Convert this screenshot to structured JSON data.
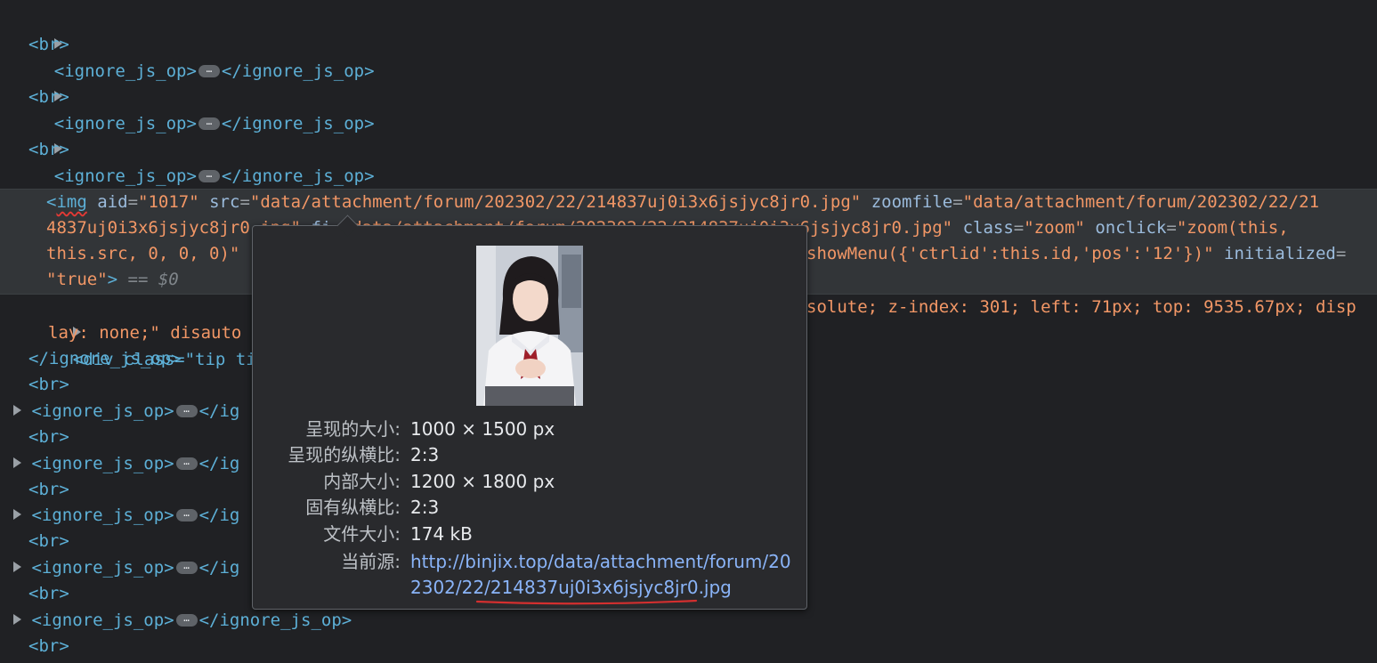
{
  "elements": {
    "ignore_tag_open": "<ignore_js_op>",
    "ignore_tag_close": "</ignore_js_op>",
    "br_tag": "<br>",
    "img_open": "<",
    "img_name": "img",
    "img_attr_aid": "aid",
    "img_val_aid": "\"1017\"",
    "img_attr_src": "src",
    "img_val_src": "\"data/attachment/forum/202302/22/214837uj0i3x6jsjyc8jr0.jpg\"",
    "img_attr_zoomfile": "zoomfile",
    "img_val_zoomfile_1": "\"data/attachment/forum/202302/22/21",
    "img_val_zoomfile_2": "4837uj0i3x6jsjyc8jr0.jpg\"",
    "img_attr_file_partial": "fi",
    "img_val_file": "\"data/attachment/forum/202302/22/214837uj0i3x6jsjyc8jr0.jpg\"",
    "img_attr_class": "class",
    "img_val_class": "\"zoom\"",
    "img_attr_onclick": "onclick",
    "img_val_onclick_1": "\"zoom(this,",
    "img_val_onclick_2": "this.src, 0, 0, 0)\"",
    "img_val_onmouseover_tail": "showMenu({'ctrlid':this.id,'pos':'12'})\"",
    "img_attr_initialized": "initialized",
    "img_val_initialized": "\"true\"",
    "img_close": ">",
    "selected_marker": "== $0",
    "div_line_1_left": "<div class=\"tip tip_",
    "div_line_1_right": "solute; z-index: 301; left: 71px; top: 9535.67px; disp",
    "div_line_2_left": "lay: none;\" disauto",
    "ignore_partial": "</ig"
  },
  "tooltip": {
    "rows": [
      {
        "label": "呈现的大小:",
        "value": "1000 × 1500 px"
      },
      {
        "label": "呈现的纵横比:",
        "value": "2:3"
      },
      {
        "label": "内部大小:",
        "value": "1200 × 1800 px"
      },
      {
        "label": "固有纵横比:",
        "value": "2:3"
      },
      {
        "label": "文件大小:",
        "value": "174 kB"
      }
    ],
    "source_label": "当前源:",
    "source_url": "http://binjix.top/data/attachment/forum/202302/22/214837uj0i3x6jsjyc8jr0.jpg"
  },
  "colors": {
    "background": "#202124",
    "tag": "#5db0d7",
    "attribute": "#9bbbdc",
    "value": "#f29766",
    "link": "#8ab4f8",
    "annotation": "#e53935"
  }
}
